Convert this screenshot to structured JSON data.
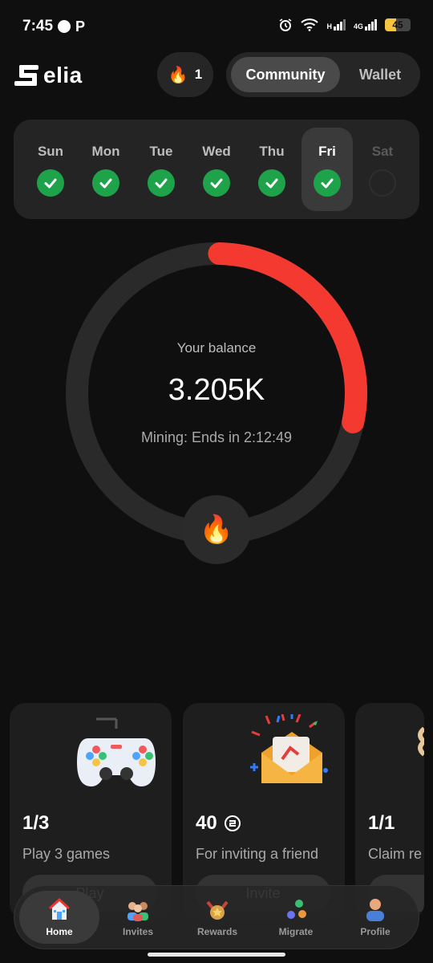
{
  "status_bar": {
    "time": "7:45",
    "app_letter": "P",
    "network_a": "H",
    "network_b": "4G",
    "battery": "45",
    "battery_level": 0.45
  },
  "header": {
    "brand": "elia",
    "streak_count": "1",
    "tabs": [
      {
        "label": "Community",
        "active": true
      },
      {
        "label": "Wallet",
        "active": false
      }
    ]
  },
  "week": {
    "days": [
      {
        "label": "Sun",
        "state": "done"
      },
      {
        "label": "Mon",
        "state": "done"
      },
      {
        "label": "Tue",
        "state": "done"
      },
      {
        "label": "Wed",
        "state": "done"
      },
      {
        "label": "Thu",
        "state": "done"
      },
      {
        "label": "Fri",
        "state": "done-today"
      },
      {
        "label": "Sat",
        "state": "future"
      }
    ]
  },
  "balance": {
    "label": "Your balance",
    "value": "3.205K",
    "mining_text": "Mining: Ends in 2:12:49",
    "progress": 0.28,
    "accent_color": "#f43a30"
  },
  "tasks": [
    {
      "count": "1/3",
      "description": "Play 3 games",
      "cta": "Play",
      "icon": "gamepad-icon"
    },
    {
      "count": "40",
      "description": "For inviting a friend",
      "cta": "Invite",
      "icon": "invite-envelope-icon"
    },
    {
      "count": "1/1",
      "description": "Claim re",
      "cta": "C",
      "icon": "reward-icon"
    }
  ],
  "nav": {
    "items": [
      {
        "label": "Home",
        "icon": "home-icon",
        "active": true
      },
      {
        "label": "Invites",
        "icon": "people-icon",
        "active": false
      },
      {
        "label": "Rewards",
        "icon": "medal-icon",
        "active": false
      },
      {
        "label": "Migrate",
        "icon": "coins-icon",
        "active": false
      },
      {
        "label": "Profile",
        "icon": "user-icon",
        "active": false
      }
    ]
  },
  "colors": {
    "background": "#0f0f0f",
    "card": "#1e1e1e",
    "check_green": "#1fa34a",
    "ring_track": "#2a2a2a"
  }
}
